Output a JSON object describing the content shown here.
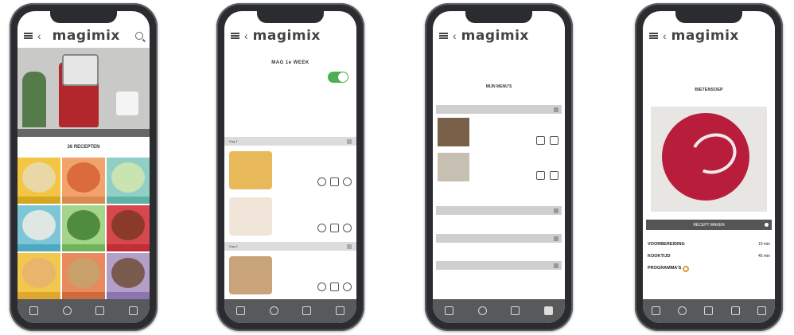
{
  "brand": "magimix",
  "screens": [
    {
      "status": {
        "left": "",
        "right": ""
      },
      "hero_caption": {
        "left": "",
        "right": ""
      },
      "section_title": "36 RECEPTEN",
      "tiles": [
        {
          "label": "",
          "bg": "#f4c542",
          "food": "#e9d8a6",
          "band": "#d6a620"
        },
        {
          "label": "",
          "bg": "#f1a36b",
          "food": "#d96b3c",
          "band": "#d9894f"
        },
        {
          "label": "",
          "bg": "#8fcfc6",
          "food": "#c9e3b1",
          "band": "#5eb1a7"
        },
        {
          "label": "",
          "bg": "#7cc6d8",
          "food": "#dfe7e2",
          "band": "#4fa8c0"
        },
        {
          "label": "",
          "bg": "#a4d58a",
          "food": "#4f8c3e",
          "band": "#6fb45a"
        },
        {
          "label": "",
          "bg": "#d8474d",
          "food": "#8b3a2a",
          "band": "#c02f36"
        },
        {
          "label": "",
          "bg": "#f2c74e",
          "food": "#e7b66c",
          "band": "#e0a72d"
        },
        {
          "label": "",
          "bg": "#e8895e",
          "food": "#c9a06a",
          "band": "#cf6a3e"
        },
        {
          "label": "",
          "bg": "#b3a0c9",
          "food": "#7a5a4c",
          "band": "#8c76b2"
        }
      ],
      "tabbar": [
        "",
        "",
        "",
        ""
      ]
    },
    {
      "status": {
        "left": "",
        "right": ""
      },
      "title": "MAG 1e WEEK",
      "description": "",
      "day1": "Dag 1",
      "day2": "Dag 2",
      "recipes": [
        {
          "name": "",
          "color": "#4a8fc9",
          "thumb": "#e7b95a"
        },
        {
          "name": "",
          "color": "#d6a620",
          "thumb": "#f1e4d9"
        },
        {
          "name": "",
          "color": "#4a8fc9",
          "thumb": "#c9a47a"
        }
      ],
      "tabbar": [
        "",
        "",
        "",
        ""
      ]
    },
    {
      "status": {
        "left": "",
        "right": ""
      },
      "title": "MIJN MENU'S",
      "rows": [
        "",
        "",
        "",
        ""
      ],
      "items": [
        {
          "name": "",
          "thumb": "#7a6048"
        },
        {
          "name": "",
          "thumb": "#c7c0b2"
        }
      ],
      "add_label": "",
      "tabbar": [
        "",
        "",
        "",
        ""
      ]
    },
    {
      "status": {
        "left": "",
        "right": ""
      },
      "title": "BIETENSOEP",
      "subtitle": "",
      "cta": "RECEPT MAKEN",
      "info": [
        {
          "label": "VOORBEREIDING",
          "value": "10 min"
        },
        {
          "label": "KOOKTIJD",
          "value": "45 min"
        },
        {
          "label": "PROGRAMMA'S",
          "value": ""
        }
      ],
      "tabbar": [
        "",
        "",
        "",
        "",
        ""
      ]
    }
  ]
}
